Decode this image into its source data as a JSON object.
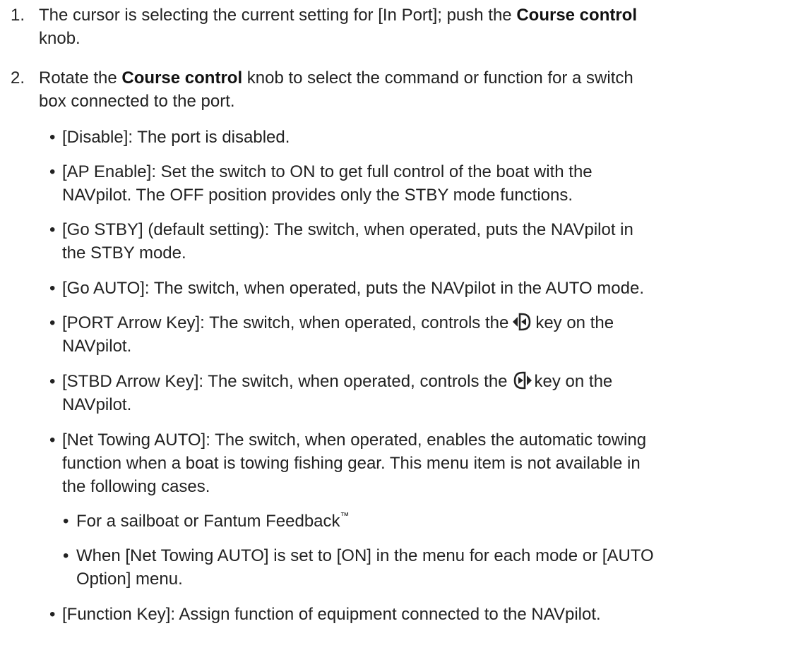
{
  "steps": [
    {
      "num": "1.",
      "pre": "The cursor is selecting the current setting for [In Port]; push the ",
      "bold": "Course control",
      "post_line1": "",
      "post": "knob."
    },
    {
      "num": "2.",
      "pre": "Rotate the ",
      "bold": "Course control",
      "post": " knob to select the command or function for a switch",
      "post2": "box connected to the port."
    }
  ],
  "bullets": {
    "disable": "[Disable]: The port is disabled.",
    "ap_enable_1": "[AP Enable]: Set the switch to ON to get full control of the boat with the",
    "ap_enable_2": "NAVpilot. The OFF position provides only the STBY mode functions.",
    "go_stby_1": "[Go STBY] (default setting): The switch, when operated, puts the NAVpilot in",
    "go_stby_2": "the STBY mode.",
    "go_auto": "[Go AUTO]: The switch, when operated, puts the NAVpilot in the AUTO mode.",
    "port_arrow_pre": "[PORT Arrow Key]: The switch, when operated, controls the",
    "port_arrow_post": "key on the",
    "port_arrow_2": "NAVpilot.",
    "stbd_arrow_pre": "[STBD Arrow Key]: The switch, when operated, controls the",
    "stbd_arrow_post": "key on the",
    "stbd_arrow_2": "NAVpilot.",
    "net_towing_1": "[Net Towing AUTO]: The switch, when operated, enables the automatic towing",
    "net_towing_2": "function when a boat is towing fishing gear. This menu item is not available in",
    "net_towing_3": "the following cases.",
    "sub_sailboat": "For a sailboat or Fantum Feedback",
    "sub_sailboat_tm": "™",
    "sub_menu_1": "When [Net Towing AUTO] is set to [ON] in the menu for each mode or [AUTO",
    "sub_menu_2": "Option] menu.",
    "function_key": "[Function Key]: Assign function of equipment connected to the NAVpilot."
  },
  "bullet_char": "•",
  "icons": {
    "port_key": "port-arrow-key-icon",
    "stbd_key": "stbd-arrow-key-icon"
  }
}
